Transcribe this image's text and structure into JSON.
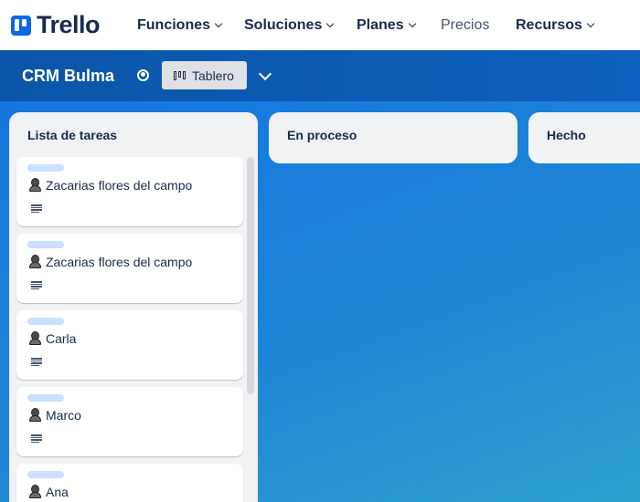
{
  "nav": {
    "logo_text": "Trello",
    "items": [
      {
        "label": "Funciones",
        "has_menu": true
      },
      {
        "label": "Soluciones",
        "has_menu": true
      },
      {
        "label": "Planes",
        "has_menu": true
      },
      {
        "label": "Precios",
        "has_menu": false
      },
      {
        "label": "Recursos",
        "has_menu": true
      }
    ]
  },
  "board": {
    "title": "CRM Bulma",
    "visibility_icon": "globe-icon",
    "view_label": "Tablero",
    "view_icon": "board-icon",
    "more_icon": "chevron-down-icon"
  },
  "lists": [
    {
      "title": "Lista de tareas",
      "cards": [
        {
          "title": "Zacarias flores del campo"
        },
        {
          "title": "Zacarias flores del campo"
        },
        {
          "title": "Carla"
        },
        {
          "title": "Marco"
        },
        {
          "title": "Ana"
        }
      ]
    },
    {
      "title": "En proceso",
      "cards": []
    },
    {
      "title": "Hecho",
      "cards": []
    }
  ],
  "colors": {
    "brand": "#0c66e4",
    "board_header": "#0d5fb8",
    "board_background_start": "#1676e0",
    "board_background_end": "#2ea0cf",
    "list_background": "#f1f2f4",
    "card_label": "#cce0ff"
  }
}
